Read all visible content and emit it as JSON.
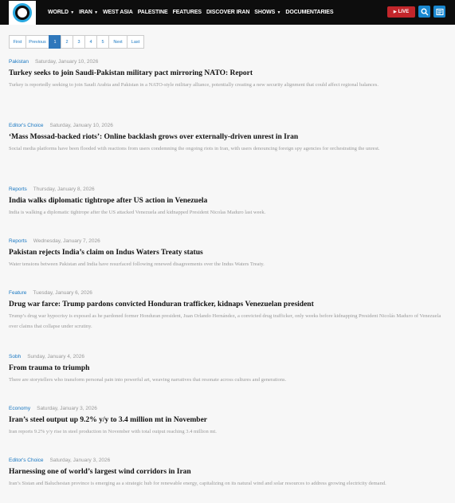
{
  "header": {
    "nav": [
      {
        "label": "WORLD",
        "dropdown": true
      },
      {
        "label": "IRAN",
        "dropdown": true
      },
      {
        "label": "WEST ASIA",
        "dropdown": false
      },
      {
        "label": "PALESTINE",
        "dropdown": false
      },
      {
        "label": "FEATURES",
        "dropdown": false
      },
      {
        "label": "DISCOVER IRAN",
        "dropdown": false
      },
      {
        "label": "SHOWS",
        "dropdown": true
      },
      {
        "label": "DOCUMENTARIES",
        "dropdown": false
      }
    ],
    "live_label": "LIVE",
    "colors": {
      "bar": "#0d0d0d",
      "live": "#c2262b",
      "icon_buttons": "#1a88d0",
      "logo_ring": "#29a9e1"
    }
  },
  "pagination": {
    "first": "First",
    "previous": "Previous",
    "pages": [
      "1",
      "2",
      "3",
      "4",
      "5"
    ],
    "current": "1",
    "next": "Next",
    "last": "Last"
  },
  "articles": [
    {
      "category": "Pakistan",
      "date": "Saturday, January 10, 2026",
      "title": "Turkey seeks to join Saudi-Pakistan military pact mirroring NATO: Report",
      "summary": "Turkey is reportedly seeking to join Saudi Arabia and Pakistan in a NATO-style military alliance, potentially creating a new security alignment that could affect regional balances."
    },
    {
      "category": "Editor's Choice",
      "date": "Saturday, January 10, 2026",
      "title": "‘Mass Mossad-backed riots’: Online backlash grows over externally-driven unrest in Iran",
      "summary": "Social media platforms have been flooded with reactions from users condemning the ongoing riots in Iran, with users denouncing foreign spy agencies for orchestrating the unrest."
    },
    {
      "category": "Reports",
      "date": "Thursday, January 8, 2026",
      "title": "India walks diplomatic tightrope after US action in Venezuela",
      "summary": "India is walking a diplomatic tightrope after the US attacked Venezuela and kidnapped President Nicolas Maduro last week."
    },
    {
      "category": "Reports",
      "date": "Wednesday, January 7, 2026",
      "title": "Pakistan rejects India’s claim on Indus Waters Treaty status",
      "summary": "Water tensions between Pakistan and India have resurfaced following renewed disagreements over the Indus Waters Treaty."
    },
    {
      "category": "Feature",
      "date": "Tuesday, January 6, 2026",
      "title": "Drug war farce: Trump pardons convicted Honduran trafficker, kidnaps Venezuelan president",
      "summary": "Trump’s drug war hypocrisy is exposed as he pardoned former Honduran president, Juan Orlando Hernández, a convicted drug trafficker, only weeks before kidnapping President Nicolás Maduro of Venezuela over claims that collapse under scrutiny."
    },
    {
      "category": "Sobh",
      "date": "Sunday, January 4, 2026",
      "title": "From trauma to triumph",
      "summary": "There are storytellers who transform personal pain into powerful art, weaving narratives that resonate across cultures and generations."
    },
    {
      "category": "Economy",
      "date": "Saturday, January 3, 2026",
      "title": "Iran’s steel output up 9.2% y/y to 3.4 million mt in November",
      "summary": "Iran reports 9.2% y/y rise in steel production in November with total output reaching 3.4 million mt."
    },
    {
      "category": "Editor's Choice",
      "date": "Saturday, January 3, 2026",
      "title": "Harnessing one of world’s largest wind corridors in Iran",
      "summary": "Iran’s Sistan and Baluchestan province is emerging as a strategic hub for renewable energy, capitalizing on its natural wind and solar resources to address growing electricity demand."
    }
  ]
}
